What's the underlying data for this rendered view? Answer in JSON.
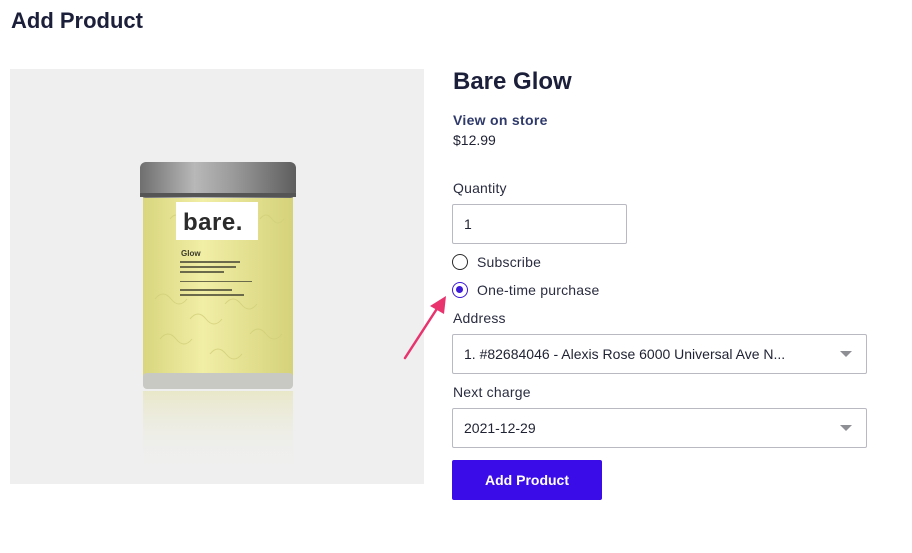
{
  "page": {
    "title": "Add Product"
  },
  "product": {
    "image_alt": "Bare Glow jar",
    "jar_brand": "bare.",
    "jar_name": "Glow",
    "name": "Bare Glow",
    "view_link": "View on store",
    "price": "$12.99"
  },
  "form": {
    "quantity_label": "Quantity",
    "quantity_value": "1",
    "purchase_options": [
      {
        "label": "Subscribe",
        "selected": false
      },
      {
        "label": "One-time purchase",
        "selected": true
      }
    ],
    "address_label": "Address",
    "address_value": "1. #82684046 - Alexis Rose 6000 Universal Ave N...",
    "next_charge_label": "Next charge",
    "next_charge_value": "2021-12-29",
    "submit_label": "Add Product"
  },
  "colors": {
    "accent": "#3a0ce8",
    "annotation_arrow": "#e8336f",
    "label_yellow": "#ecea9c"
  },
  "icons": [
    "chevron-down-icon",
    "annotation-arrow-icon"
  ]
}
